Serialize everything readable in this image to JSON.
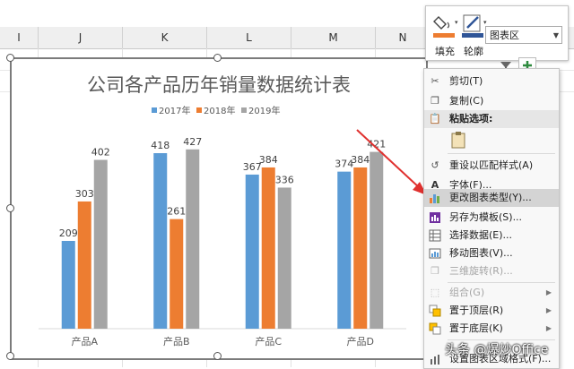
{
  "columns": [
    "I",
    "J",
    "K",
    "L",
    "M",
    "N"
  ],
  "chart_data": {
    "type": "bar",
    "title": "公司各产品历年销量数据统计表",
    "categories": [
      "产品A",
      "产品B",
      "产品C",
      "产品D"
    ],
    "series": [
      {
        "name": "2017年",
        "color": "#5b9bd5",
        "values": [
          209,
          418,
          367,
          374
        ]
      },
      {
        "name": "2018年",
        "color": "#ed7d31",
        "values": [
          303,
          261,
          384,
          384
        ]
      },
      {
        "name": "2019年",
        "color": "#a5a5a5",
        "values": [
          402,
          427,
          336,
          421
        ]
      }
    ],
    "ylim": [
      0,
      450
    ],
    "grid": false,
    "legend": "top"
  },
  "mini_toolbar": {
    "fill_label": "填充",
    "outline_label": "轮廓",
    "element_select": "图表区"
  },
  "context_menu": {
    "items": [
      {
        "label": "剪切(T)",
        "icon": "scissors-icon",
        "disabled": false
      },
      {
        "label": "复制(C)",
        "icon": "copy-icon",
        "disabled": false
      },
      {
        "label": "粘贴选项:",
        "icon": "paste-icon",
        "disabled": false
      },
      {
        "label": "重设以匹配样式(A)",
        "icon": "reset-style-icon",
        "disabled": false
      },
      {
        "label": "字体(F)...",
        "icon": "font-icon",
        "disabled": false
      },
      {
        "label": "更改图表类型(Y)...",
        "icon": "chart-type-icon",
        "disabled": false,
        "highlighted": true
      },
      {
        "label": "另存为模板(S)...",
        "icon": "template-icon",
        "disabled": false
      },
      {
        "label": "选择数据(E)...",
        "icon": "select-data-icon",
        "disabled": false
      },
      {
        "label": "移动图表(V)...",
        "icon": "move-chart-icon",
        "disabled": false
      },
      {
        "label": "三维旋转(R)...",
        "icon": "rotate-3d-icon",
        "disabled": true
      },
      {
        "label": "组合(G)",
        "icon": "group-icon",
        "disabled": true,
        "submenu": true
      },
      {
        "label": "置于顶层(R)",
        "icon": "bring-front-icon",
        "disabled": false,
        "submenu": true
      },
      {
        "label": "置于底层(K)",
        "icon": "send-back-icon",
        "disabled": false,
        "submenu": true
      },
      {
        "label": "设置图表区域格式(F)...",
        "icon": "format-icon",
        "disabled": false
      }
    ]
  },
  "watermark": "头条 @爆炒Office"
}
